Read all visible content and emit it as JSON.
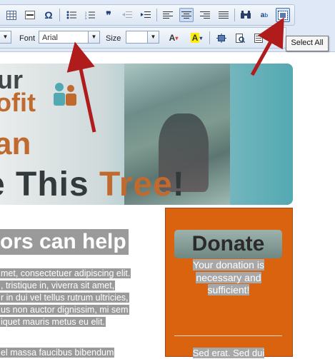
{
  "toolbar": {
    "font_label": "Font",
    "font_value": "Arial",
    "size_label": "Size",
    "size_value": "",
    "tooltip": "Select All"
  },
  "banner": {
    "logo_line1": "ur",
    "logo_line2": "ofit",
    "orange_text": "an",
    "headline_part1": "e This ",
    "headline_part2": "Tree",
    "headline_part3": "!"
  },
  "content": {
    "heading": "ors can help",
    "para1_lines": [
      "met, consectetuer adipiscing elit.",
      ", tristique in, viverra sit amet,",
      "r in dui vel tellus rutrum ultricies,",
      "us non auctor dignissim, mi sem",
      "iquet mauris metus eu elit."
    ],
    "para2": "el massa faucibus bibendum"
  },
  "donate": {
    "button": "Donate",
    "text": "Your donation is necessary and sufficient!",
    "footer": "Sed erat. Sed dui"
  },
  "colors": {
    "accent_orange": "#d9630f",
    "arrow_red": "#b01c1c",
    "teal": "#53a9b2"
  }
}
